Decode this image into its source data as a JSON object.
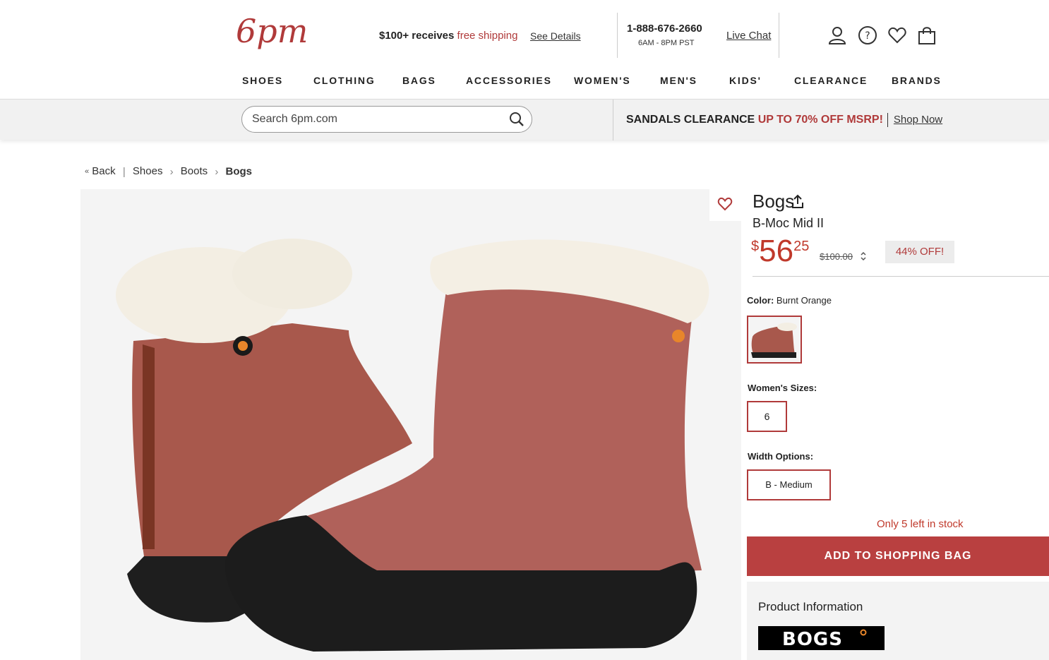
{
  "header": {
    "logo_text": "6pm",
    "shipping_bold": "$100+ receives",
    "shipping_free": "free shipping",
    "see_details": "See Details",
    "phone": "1-888-676-2660",
    "hours": "6AM - 8PM PST",
    "live_chat": "Live Chat",
    "icons": [
      "account-icon",
      "help-icon",
      "favorites-icon",
      "bag-icon"
    ]
  },
  "nav": {
    "items": [
      "SHOES",
      "CLOTHING",
      "BAGS",
      "ACCESSORIES",
      "WOMEN'S",
      "MEN'S",
      "KIDS'",
      "CLEARANCE",
      "BRANDS"
    ]
  },
  "search": {
    "placeholder": "Search 6pm.com"
  },
  "promo": {
    "label": "SANDALS CLEARANCE",
    "highlight": "UP TO 70% OFF MSRP!",
    "link": "Shop Now"
  },
  "breadcrumb": {
    "back": "Back",
    "items": [
      "Shoes",
      "Boots",
      "Bogs"
    ]
  },
  "product": {
    "brand": "Bogs",
    "name": "B-Moc Mid II",
    "price_currency": "$",
    "price_dollars": "56",
    "price_cents": "25",
    "original_price": "$100.00",
    "discount": "44% OFF!",
    "color_label": "Color:",
    "color_value": "Burnt Orange",
    "sizes_label": "Women's Sizes:",
    "size_selected": "6",
    "width_label": "Width Options:",
    "width_selected": "B - Medium",
    "stock": "Only 5 left in stock",
    "add_to_bag": "ADD TO SHOPPING BAG",
    "info_title": "Product Information",
    "brand_logo_text": "BOGS"
  },
  "colors": {
    "accent": "#b03a3a",
    "button": "#b94040",
    "boot": "#a8584c",
    "sole": "#1e1e1e",
    "fleece": "#f3eee3"
  }
}
